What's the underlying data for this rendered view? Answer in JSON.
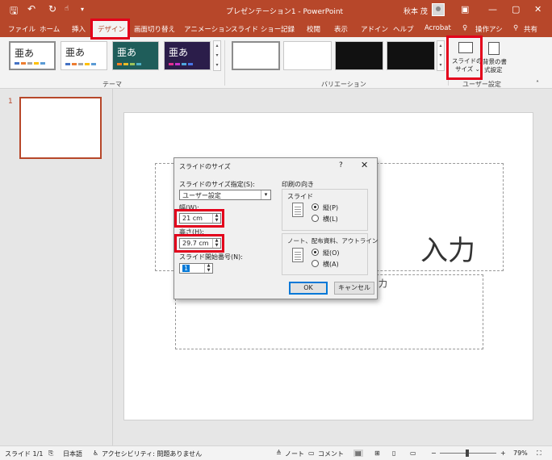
{
  "titlebar": {
    "save_icon": "save-icon",
    "undo_icon": "undo-icon",
    "redo_icon": "redo-icon",
    "title": "プレゼンテーション1 - PowerPoint",
    "user": "秋本 茂",
    "window_controls": [
      "—",
      "▢",
      "—",
      "▢",
      "✕"
    ]
  },
  "tabs": [
    "ファイル",
    "ホーム",
    "挿入",
    "デザイン",
    "画面切り替え",
    "アニメーション",
    "スライド ショー",
    "記録",
    "校閲",
    "表示",
    "アドイン",
    "ヘルプ",
    "Acrobat",
    "操作アシ",
    "共有"
  ],
  "ribbon": {
    "themes_group": "テーマ",
    "variations_group": "バリエーション",
    "user_group": "ユーザー設定",
    "theme_glyph": "亜あ",
    "slide_size_label_1": "スライドの",
    "slide_size_label_2": "サイズ ⌄",
    "background_label_1": "背景の書",
    "background_label_2": "式設定"
  },
  "thumbnail": {
    "number": "1"
  },
  "slide": {
    "title_text": "入力",
    "subtitle_text": "カ"
  },
  "dialog": {
    "title": "スライドのサイズ",
    "help": "?",
    "close": "✕",
    "size_label": "スライドのサイズ指定(S):",
    "size_value": "ユーザー設定",
    "width_label": "幅(W):",
    "width_value": "21 cm",
    "height_label": "高さ(H):",
    "height_value": "29.7 cm",
    "start_label": "スライド開始番号(N):",
    "start_value": "1",
    "orientation_label": "印刷の向き",
    "slide_group_label": "スライド",
    "slide_portrait": "縦(P)",
    "slide_landscape": "横(L)",
    "notes_group_label": "ノート、配布資料、アウトライン",
    "notes_portrait": "縦(O)",
    "notes_landscape": "横(A)",
    "ok": "OK",
    "cancel": "キャンセル"
  },
  "statusbar": {
    "slide_count": "スライド 1/1",
    "language": "日本語",
    "accessibility": "アクセシビリティ: 問題ありません",
    "notes": "ノート",
    "comments": "コメント",
    "zoom": "79%"
  },
  "colors": {
    "accent": "#b7472a",
    "highlight": "#e3001b"
  }
}
